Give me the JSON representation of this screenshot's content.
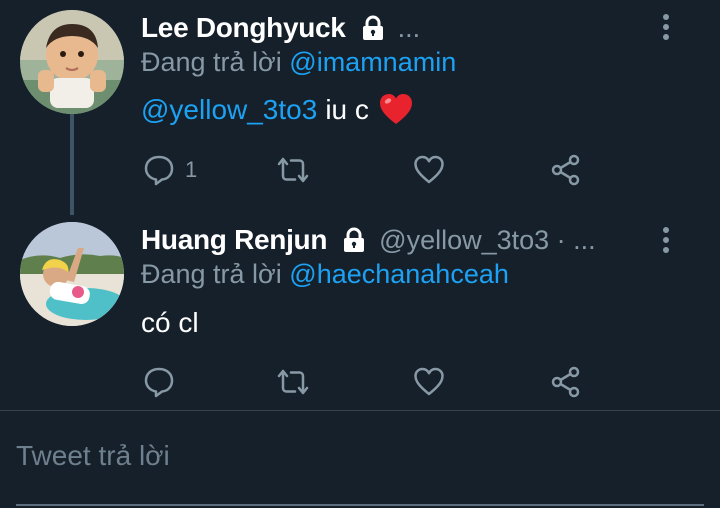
{
  "tweets": [
    {
      "name": "Lee Donghyuck",
      "handle": "...",
      "reply_prefix": "Đang trả lời",
      "reply_to": "@imamnamin",
      "mention": "@yellow_3to3",
      "text": "iu c",
      "emoji": "heart-emoji",
      "reply_count": "1",
      "icons": [
        "lock-icon",
        "more-vertical-icon",
        "reply-icon",
        "retweet-icon",
        "like-icon",
        "share-icon"
      ]
    },
    {
      "name": "Huang Renjun",
      "handle": "@yellow_3to3 · ...",
      "reply_prefix": "Đang trả lời",
      "reply_to": "@haechanahceah",
      "text": "có cl",
      "reply_count": "",
      "icons": [
        "lock-icon",
        "more-vertical-icon",
        "reply-icon",
        "retweet-icon",
        "like-icon",
        "share-icon"
      ]
    }
  ],
  "composer": {
    "placeholder": "Tweet trả lời"
  },
  "colors": {
    "background": "#15202b",
    "accent": "#1da1f2",
    "secondary_text": "#8899a6",
    "heart": "#e0245e"
  }
}
